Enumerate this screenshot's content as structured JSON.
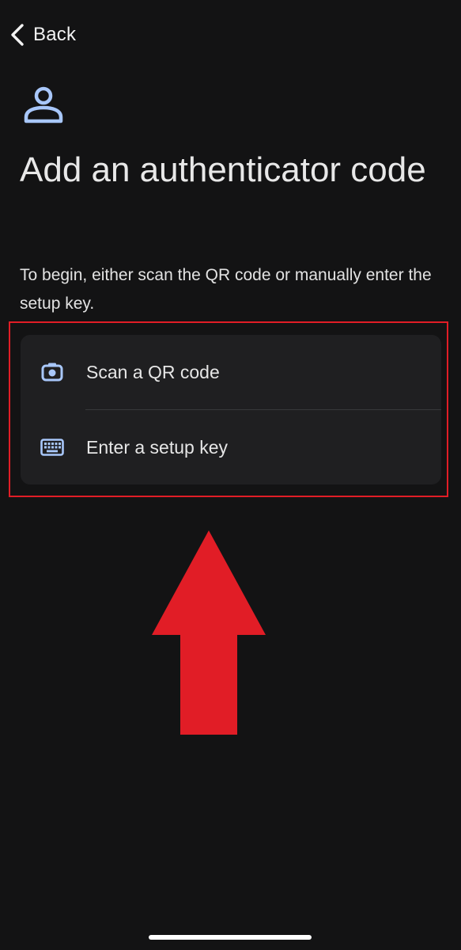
{
  "nav": {
    "back_label": "Back"
  },
  "header": {
    "icon": "person-icon",
    "title": "Add an authenticator code",
    "description": "To begin, either scan the QR code or manually enter the setup key."
  },
  "options": [
    {
      "label": "Scan a QR code",
      "icon": "camera-icon"
    },
    {
      "label": "Enter a setup key",
      "icon": "keyboard-icon"
    }
  ],
  "annotation": {
    "highlight_color": "#e11d26",
    "arrow_color": "#e11d26"
  },
  "colors": {
    "background": "#131314",
    "card": "#1f1f21",
    "accent": "#a8c7fa"
  }
}
